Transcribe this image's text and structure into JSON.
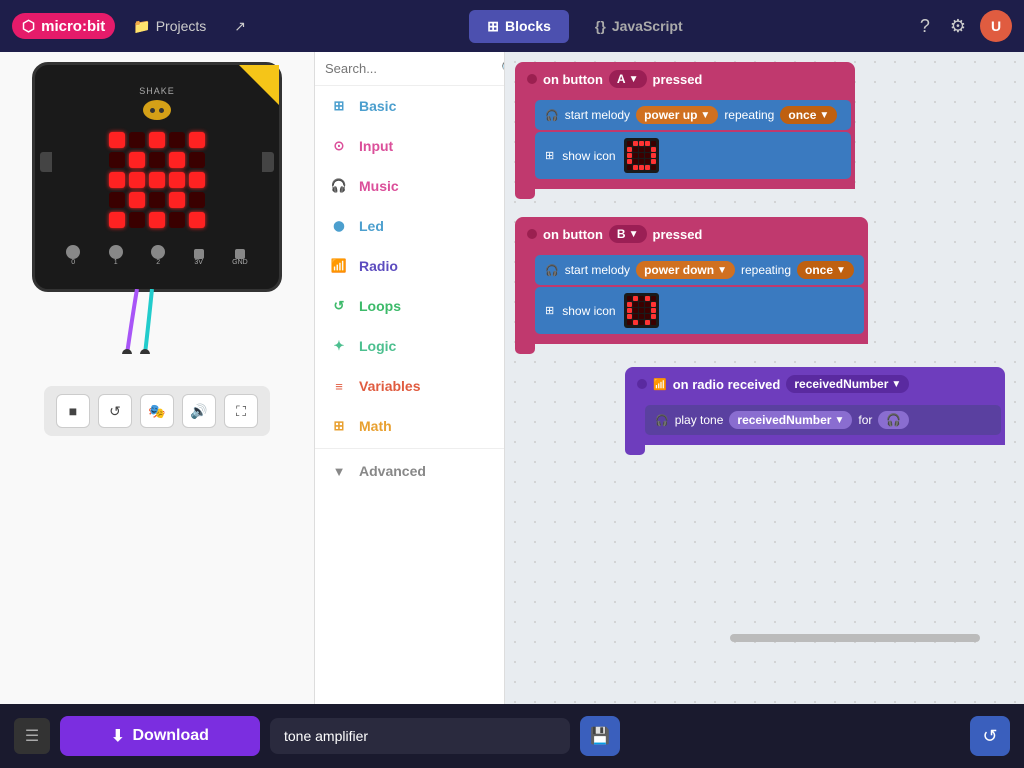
{
  "app": {
    "title": "micro:bit",
    "logo_text": "micro:bit"
  },
  "topnav": {
    "projects_label": "Projects",
    "blocks_label": "Blocks",
    "javascript_label": "JavaScript"
  },
  "simulator": {
    "label": "SHAKE"
  },
  "sim_controls": {
    "stop": "■",
    "restart": "↺",
    "screenshot": "🎭",
    "volume": "🔊",
    "fullscreen": "⛶"
  },
  "toolbox": {
    "search_placeholder": "Search...",
    "items": [
      {
        "id": "basic",
        "label": "Basic",
        "icon": "⊞",
        "color": "ti-basic"
      },
      {
        "id": "input",
        "label": "Input",
        "icon": "⊙",
        "color": "ti-input"
      },
      {
        "id": "music",
        "label": "Music",
        "icon": "🎧",
        "color": "ti-music"
      },
      {
        "id": "led",
        "label": "Led",
        "icon": "⬤",
        "color": "ti-led"
      },
      {
        "id": "radio",
        "label": "Radio",
        "icon": "📶",
        "color": "ti-radio"
      },
      {
        "id": "loops",
        "label": "Loops",
        "icon": "↺",
        "color": "ti-loops"
      },
      {
        "id": "logic",
        "label": "Logic",
        "icon": "✦",
        "color": "ti-logic"
      },
      {
        "id": "variables",
        "label": "Variables",
        "icon": "≡",
        "color": "ti-variables"
      },
      {
        "id": "math",
        "label": "Math",
        "icon": "⊞",
        "color": "ti-math"
      },
      {
        "id": "advanced",
        "label": "Advanced",
        "icon": "▼",
        "color": "ti-advanced"
      }
    ]
  },
  "blocks": {
    "group1": {
      "event_label": "on button",
      "button_val": "A",
      "pressed_label": "pressed",
      "melody_label": "start melody",
      "melody_val": "power up",
      "repeating_label": "repeating",
      "once_val": "once",
      "show_icon_label": "show icon"
    },
    "group2": {
      "event_label": "on button",
      "button_val": "B",
      "pressed_label": "pressed",
      "melody_label": "start melody",
      "melody_val": "power down",
      "repeating_label": "repeating",
      "once_val": "once",
      "show_icon_label": "show icon"
    },
    "group3": {
      "event_label": "on radio received",
      "param_label": "receivedNumber",
      "play_label": "play tone",
      "freq_label": "receivedNumber",
      "for_label": "for"
    }
  },
  "bottom": {
    "project_name": "tone amplifier",
    "download_label": "Download"
  }
}
